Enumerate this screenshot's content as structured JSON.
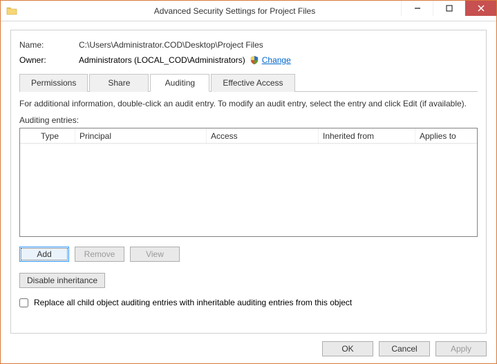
{
  "window": {
    "title": "Advanced Security Settings for Project Files"
  },
  "fields": {
    "name_label": "Name:",
    "name_value": "C:\\Users\\Administrator.COD\\Desktop\\Project Files",
    "owner_label": "Owner:",
    "owner_value": "Administrators (LOCAL_COD\\Administrators)",
    "change_link": "Change"
  },
  "tabs": {
    "permissions": "Permissions",
    "share": "Share",
    "auditing": "Auditing",
    "effective": "Effective Access"
  },
  "info_text": "For additional information, double-click an audit entry. To modify an audit entry, select the entry and click Edit (if available).",
  "entries_label": "Auditing entries:",
  "columns": {
    "type": "Type",
    "principal": "Principal",
    "access": "Access",
    "inherited": "Inherited from",
    "applies": "Applies to"
  },
  "buttons": {
    "add": "Add",
    "remove": "Remove",
    "view": "View",
    "disable_inheritance": "Disable inheritance",
    "ok": "OK",
    "cancel": "Cancel",
    "apply": "Apply"
  },
  "checkbox_label": "Replace all child object auditing entries with inheritable auditing entries from this object"
}
